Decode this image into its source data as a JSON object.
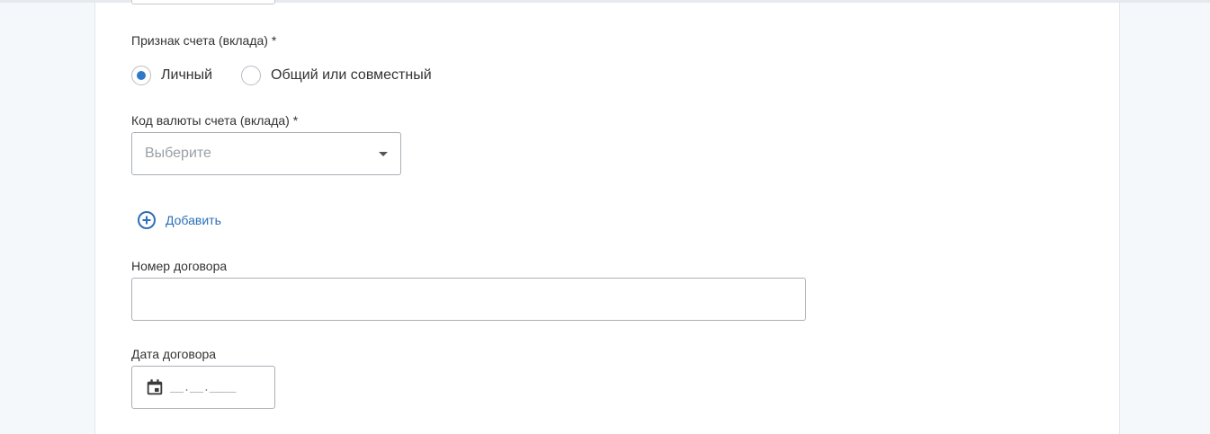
{
  "form": {
    "account_type": {
      "label": "Признак счета (вклада) *",
      "options": [
        {
          "label": "Личный",
          "selected": true
        },
        {
          "label": "Общий или совместный",
          "selected": false
        }
      ]
    },
    "currency": {
      "label": "Код валюты счета (вклада) *",
      "placeholder": "Выберите"
    },
    "add_link": {
      "label": "Добавить",
      "icon": "plus-circle-icon"
    },
    "contract_number": {
      "label": "Номер договора",
      "value": ""
    },
    "contract_date": {
      "label": "Дата договора",
      "mask": "__.__.____",
      "icon": "calendar-icon"
    }
  },
  "colors": {
    "accent": "#2d79c7",
    "link": "#2d6fb8",
    "border": "#a9afb5",
    "page_background": "#f4f8fb"
  }
}
